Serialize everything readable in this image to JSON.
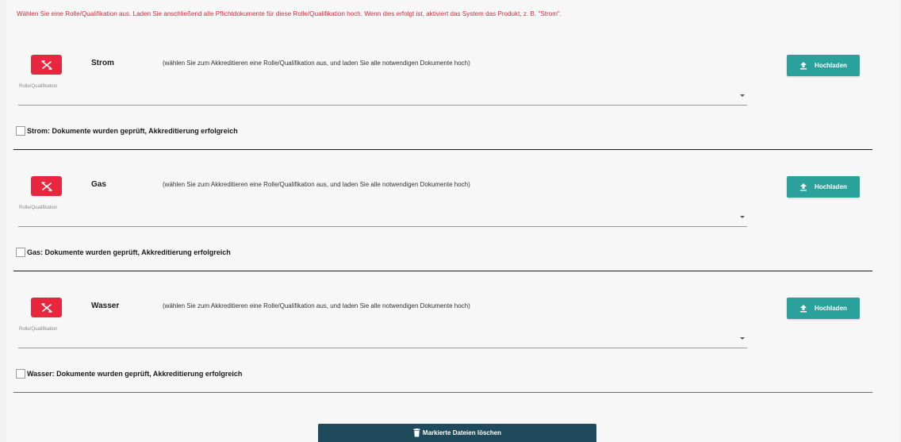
{
  "instruction": "Wählen Sie eine Rolle/Qualifikation aus. Laden Sie anschließend alle Pflichtdokumente für diese Rolle/Qualifikation hoch. Wenn dies erfolgt ist, aktiviert das System das Produkt, z. B. \"Strom\".",
  "colors": {
    "alert_text": "#e6253c",
    "role_button": "#e8263d",
    "upload_button": "#2aa19b",
    "delete_button": "#1f4a5b"
  },
  "icons": {
    "role": "crossed-tools-icon",
    "upload": "upload-icon",
    "dropdown": "chevron-down-icon",
    "delete": "trash-icon"
  },
  "sections": [
    {
      "name": "Strom",
      "hint": "(wählen Sie zum Akkreditieren eine Rolle/Qualifikation aus, und laden Sie alle notwendigen Dokumente hoch)",
      "role_caption": "Rolle/Qualifikation",
      "select_value": "",
      "upload_label": "Hochladen",
      "checkbox_label": "Strom: Dokumente wurden geprüft, Akkreditierung erfolgreich",
      "checked": false
    },
    {
      "name": "Gas",
      "hint": "(wählen Sie zum Akkreditieren eine Rolle/Qualifikation aus, und laden Sie alle notwendigen Dokumente hoch)",
      "role_caption": "Rolle/Qualifikation",
      "select_value": "",
      "upload_label": "Hochladen",
      "checkbox_label": "Gas: Dokumente wurden geprüft, Akkreditierung erfolgreich",
      "checked": false
    },
    {
      "name": "Wasser",
      "hint": "(wählen Sie zum Akkreditieren eine Rolle/Qualifikation aus, und laden Sie alle notwendigen Dokumente hoch)",
      "role_caption": "Rolle/Qualifikation",
      "select_value": "",
      "upload_label": "Hochladen",
      "checkbox_label": "Wasser: Dokumente wurden geprüft, Akkreditierung erfolgreich",
      "checked": false
    }
  ],
  "delete_button_label": "Markierte Dateien löschen"
}
